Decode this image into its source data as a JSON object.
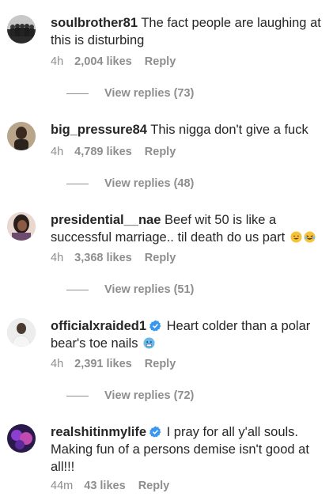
{
  "comments": [
    {
      "username": "soulbrother81",
      "verified": false,
      "text": "The fact people are laughing at this is disturbing",
      "emoji": [],
      "time": "4h",
      "likes": "2,004 likes",
      "reply_label": "Reply",
      "view_replies": "View replies (73)"
    },
    {
      "username": "big_pressure84",
      "verified": false,
      "text": "This nigga don't give a fuck",
      "emoji": [],
      "time": "4h",
      "likes": "4,789 likes",
      "reply_label": "Reply",
      "view_replies": "View replies (48)"
    },
    {
      "username": "presidential__nae",
      "verified": false,
      "text": "Beef wit 50 is like a successful marriage.. til death do us part",
      "emoji": [
        "sweat-smile-emoji",
        "laughing-tears-emoji"
      ],
      "time": "4h",
      "likes": "3,368 likes",
      "reply_label": "Reply",
      "view_replies": "View replies (51)"
    },
    {
      "username": "officialxraided1",
      "verified": true,
      "text": "Heart colder than a polar bear's toe nails",
      "emoji": [
        "cold-face-emoji"
      ],
      "time": "4h",
      "likes": "2,391 likes",
      "reply_label": "Reply",
      "view_replies": "View replies (72)"
    },
    {
      "username": "realshitinmylife",
      "verified": true,
      "text": "I pray for all y'all souls. Making fun of a persons demise isn't good at all!!!",
      "emoji": [],
      "time": "44m",
      "likes": "43 likes",
      "reply_label": "Reply"
    }
  ],
  "colors": {
    "text": "#262626",
    "secondary": "#8e8e8e",
    "verified_blue": "#3897f0"
  }
}
